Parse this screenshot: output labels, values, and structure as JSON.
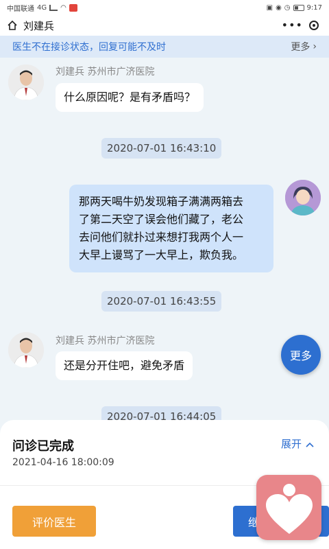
{
  "status_bar": {
    "carrier": "中国联通",
    "network": "4G",
    "time": "9:17"
  },
  "nav": {
    "title": "刘建兵"
  },
  "notice": {
    "text": "医生不在接诊状态，回复可能不及时",
    "more_label": "更多"
  },
  "messages": [
    {
      "type": "doctor",
      "sender": "刘建兵 苏州市广济医院",
      "text": "什么原因呢？是有矛盾吗？"
    },
    {
      "type": "time",
      "text": "2020-07-01 16:43:10"
    },
    {
      "type": "user",
      "lines": [
        "那两天喝牛奶发现箱子满满两箱去",
        "了第二天空了误会他们藏了，老公",
        "去问他们就扑过来想打我两个人一",
        "大早上谩骂了一大早上，欺负我。"
      ]
    },
    {
      "type": "time",
      "text": "2020-07-01 16:43:55"
    },
    {
      "type": "doctor",
      "sender": "刘建兵 苏州市广济医院",
      "text": "还是分开住吧，避免矛盾"
    },
    {
      "type": "time",
      "text": "2020-07-01 16:44:05"
    }
  ],
  "fab": {
    "label": "更多"
  },
  "panel": {
    "status": "问诊已完成",
    "datetime": "2021-04-16 18:00:09",
    "expand_label": "展开",
    "evaluate_label": "评价医生",
    "continue_label": "继"
  },
  "colors": {
    "accent_blue": "#2d6fd0",
    "orange": "#f0a038",
    "user_bubble": "#cfe3fb",
    "background": "#eef4f8",
    "widget_pink": "#e8868a"
  }
}
